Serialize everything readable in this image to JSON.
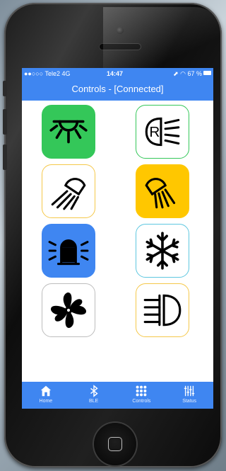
{
  "status_bar": {
    "carrier": "●●○○○ Tele2  4G",
    "time": "14:47",
    "right": "⬈ ◠ 67 %"
  },
  "nav": {
    "title": "Controls - [Connected]"
  },
  "controls": [
    {
      "icon": "dome-light-icon",
      "bg": "#34c759",
      "border": "#34c759"
    },
    {
      "icon": "rear-fog-light-icon",
      "bg": "#ffffff",
      "border": "#34c759"
    },
    {
      "icon": "work-light-icon",
      "bg": "#ffffff",
      "border": "#f5c84a"
    },
    {
      "icon": "work-light-icon",
      "bg": "#ffc700",
      "border": "#ffc700"
    },
    {
      "icon": "beacon-light-icon",
      "bg": "#3f86f1",
      "border": "#3f86f1"
    },
    {
      "icon": "snowflake-icon",
      "bg": "#ffffff",
      "border": "#5ec7e0"
    },
    {
      "icon": "fan-icon",
      "bg": "#ffffff",
      "border": "#bdbdbd"
    },
    {
      "icon": "front-fog-light-icon",
      "bg": "#ffffff",
      "border": "#f5c84a"
    }
  ],
  "tabs": [
    {
      "label": "Home",
      "icon": "home-icon"
    },
    {
      "label": "BLE",
      "icon": "bluetooth-icon"
    },
    {
      "label": "Controls",
      "icon": "grid-icon"
    },
    {
      "label": "Status",
      "icon": "sliders-icon"
    }
  ],
  "colors": {
    "accent": "#3f86f1"
  }
}
